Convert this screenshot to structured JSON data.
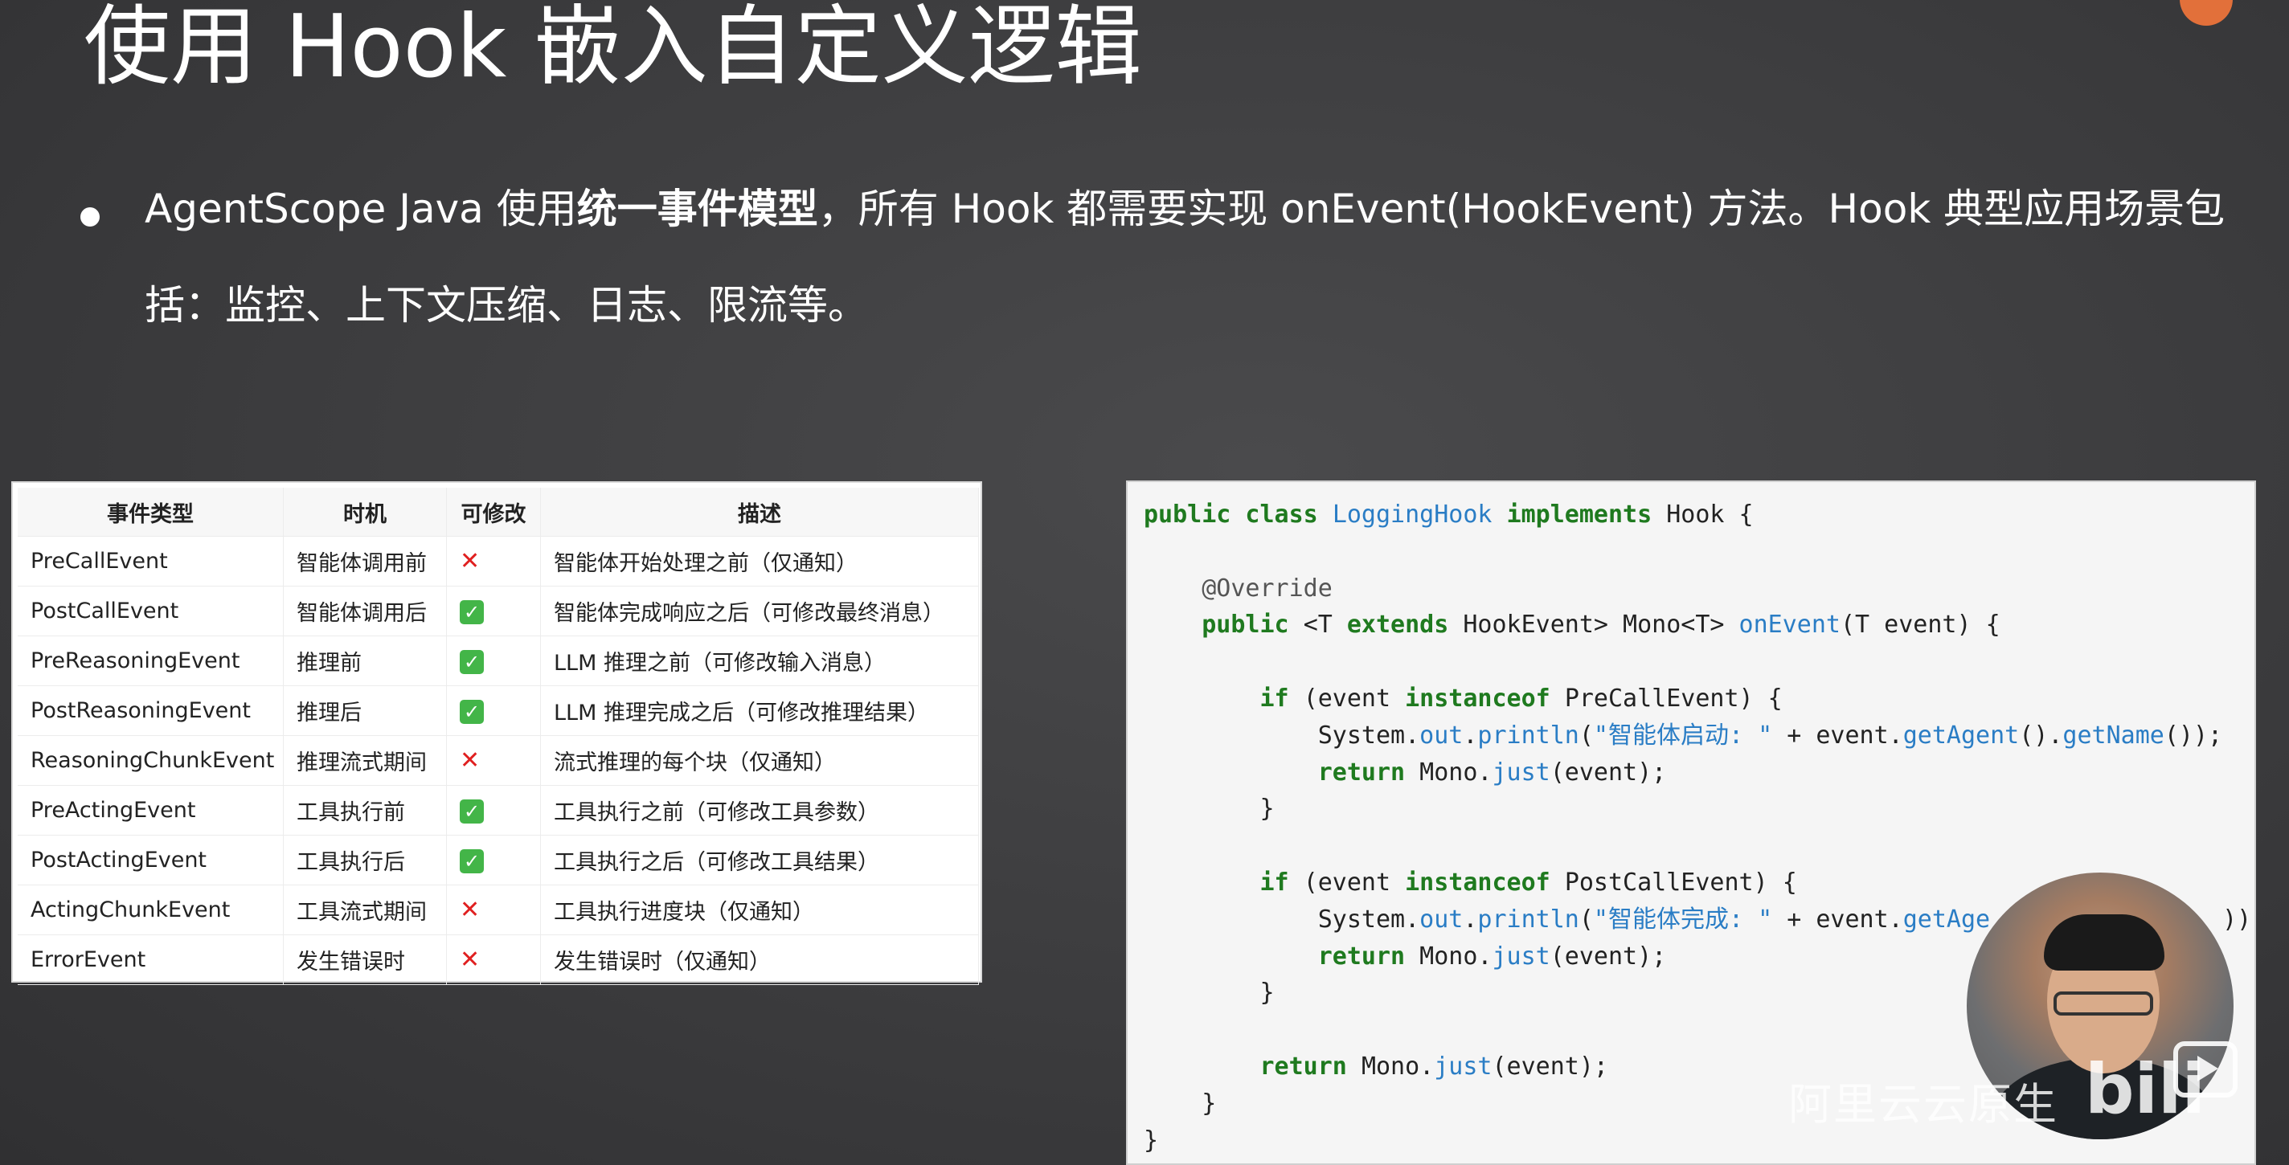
{
  "slide": {
    "title": "使用 Hook 嵌入自定义逻辑",
    "bullet": {
      "before": "AgentScope Java 使用",
      "bold": "统一事件模型",
      "after": "，所有 Hook 都需要实现 onEvent(HookEvent) 方法。Hook 典型应用场景包括：监控、上下文压缩、日志、限流等。"
    }
  },
  "table": {
    "headers": [
      "事件类型",
      "时机",
      "可修改",
      "描述"
    ],
    "rows": [
      {
        "event": "PreCallEvent",
        "timing": "智能体调用前",
        "modifiable": false,
        "desc": "智能体开始处理之前（仅通知）"
      },
      {
        "event": "PostCallEvent",
        "timing": "智能体调用后",
        "modifiable": true,
        "desc": "智能体完成响应之后（可修改最终消息）"
      },
      {
        "event": "PreReasoningEvent",
        "timing": "推理前",
        "modifiable": true,
        "desc": "LLM 推理之前（可修改输入消息）"
      },
      {
        "event": "PostReasoningEvent",
        "timing": "推理后",
        "modifiable": true,
        "desc": "LLM 推理完成之后（可修改推理结果）"
      },
      {
        "event": "ReasoningChunkEvent",
        "timing": "推理流式期间",
        "modifiable": false,
        "desc": "流式推理的每个块（仅通知）"
      },
      {
        "event": "PreActingEvent",
        "timing": "工具执行前",
        "modifiable": true,
        "desc": "工具执行之前（可修改工具参数）"
      },
      {
        "event": "PostActingEvent",
        "timing": "工具执行后",
        "modifiable": true,
        "desc": "工具执行之后（可修改工具结果）"
      },
      {
        "event": "ActingChunkEvent",
        "timing": "工具流式期间",
        "modifiable": false,
        "desc": "工具执行进度块（仅通知）"
      },
      {
        "event": "ErrorEvent",
        "timing": "发生错误时",
        "modifiable": false,
        "desc": "发生错误时（仅通知）"
      }
    ],
    "mark_yes": "✓",
    "mark_no": "✕"
  },
  "code": {
    "lines": [
      [
        [
          "kw",
          "public class "
        ],
        [
          "cls",
          "LoggingHook "
        ],
        [
          "kw",
          "implements "
        ],
        [
          "",
          "Hook {"
        ]
      ],
      [],
      [
        [
          "ann",
          "    @Override"
        ]
      ],
      [
        [
          "kw",
          "    public "
        ],
        [
          "",
          "<T "
        ],
        [
          "kw",
          "extends "
        ],
        [
          "",
          "HookEvent> Mono<T> "
        ],
        [
          "fn",
          "onEvent"
        ],
        [
          "",
          "(T event) {"
        ]
      ],
      [],
      [
        [
          "kw",
          "        if "
        ],
        [
          "",
          "(event "
        ],
        [
          "kw",
          "instanceof "
        ],
        [
          "",
          "PreCallEvent) {"
        ]
      ],
      [
        [
          "",
          "            System."
        ],
        [
          "fn",
          "out"
        ],
        [
          "",
          "."
        ],
        [
          "fn",
          "println"
        ],
        [
          "",
          "("
        ],
        [
          "str",
          "\"智能体启动: \""
        ],
        [
          "",
          " + event."
        ],
        [
          "fn",
          "getAgent"
        ],
        [
          "",
          "()."
        ],
        [
          "fn",
          "getName"
        ],
        [
          "",
          "());"
        ]
      ],
      [
        [
          "kw",
          "            return "
        ],
        [
          "",
          "Mono."
        ],
        [
          "fn",
          "just"
        ],
        [
          "",
          "(event);"
        ]
      ],
      [
        [
          "",
          "        }"
        ]
      ],
      [],
      [
        [
          "kw",
          "        if "
        ],
        [
          "",
          "(event "
        ],
        [
          "kw",
          "instanceof "
        ],
        [
          "",
          "PostCallEvent) {"
        ]
      ],
      [
        [
          "",
          "            System."
        ],
        [
          "fn",
          "out"
        ],
        [
          "",
          "."
        ],
        [
          "fn",
          "println"
        ],
        [
          "",
          "("
        ],
        [
          "str",
          "\"智能体完成: \""
        ],
        [
          "",
          " + event."
        ],
        [
          "fn",
          "getAge"
        ],
        [
          "",
          "                ));"
        ]
      ],
      [
        [
          "kw",
          "            return "
        ],
        [
          "",
          "Mono."
        ],
        [
          "fn",
          "just"
        ],
        [
          "",
          "(event);"
        ]
      ],
      [
        [
          "",
          "        }"
        ]
      ],
      [],
      [
        [
          "kw",
          "        return "
        ],
        [
          "",
          "Mono."
        ],
        [
          "fn",
          "just"
        ],
        [
          "",
          "(event);"
        ]
      ],
      [
        [
          "",
          "    }"
        ]
      ],
      [
        [
          "",
          "}"
        ]
      ]
    ]
  },
  "overlay": {
    "watermark": "阿里云云原生",
    "bili_logo": "bili"
  }
}
